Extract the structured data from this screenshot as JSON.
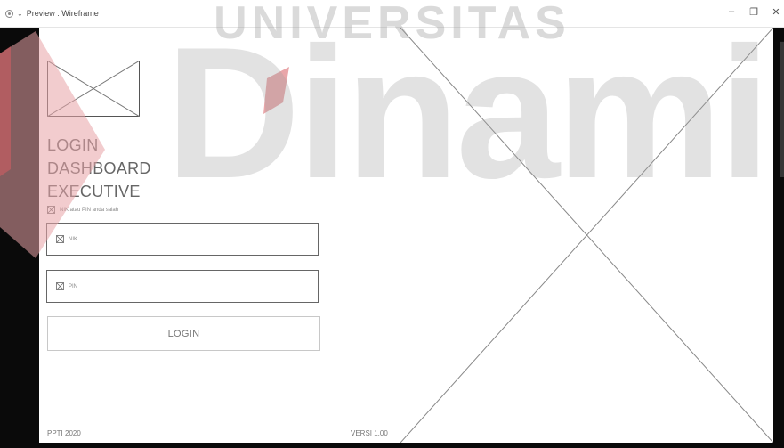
{
  "window": {
    "title": "Preview : Wireframe",
    "controls": {
      "minimize": "–",
      "restore": "❐",
      "close": "✕"
    }
  },
  "login": {
    "title_lines": [
      "LOGIN",
      "DASHBOARD",
      "EXECUTIVE"
    ],
    "error_message": "NIK atau PIN anda salah",
    "nik_placeholder": "NIK",
    "pin_placeholder": "PIN",
    "login_button": "LOGIN",
    "footer_left": "PPTI 2020",
    "footer_right": "VERSI 1.00"
  },
  "watermark": {
    "top_text": "UNIVERSITAS",
    "main_text": "Dinamil",
    "logo_colors": [
      "#e8a2a6",
      "#d75c62"
    ]
  }
}
